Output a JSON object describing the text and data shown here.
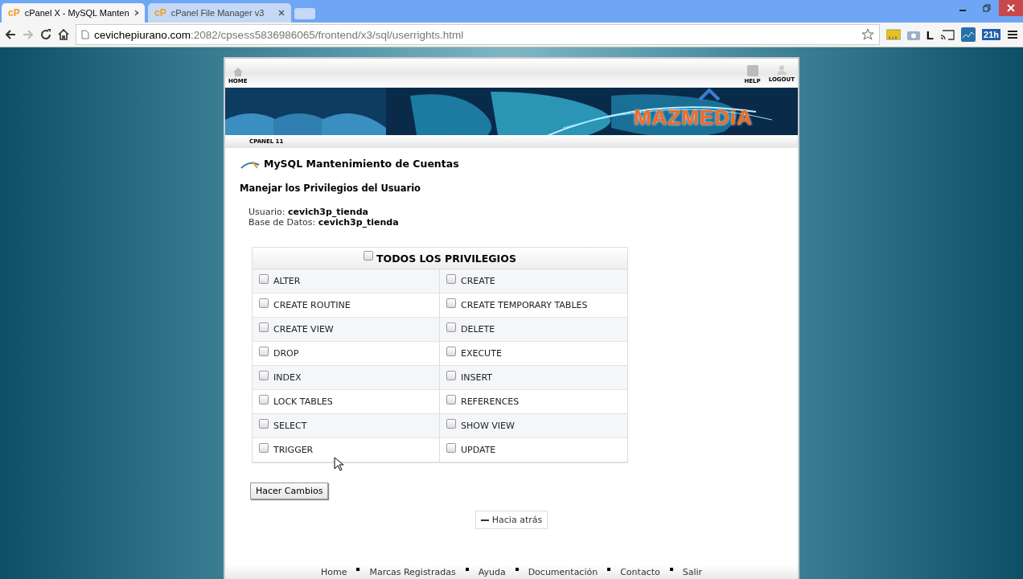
{
  "browser": {
    "tabs": [
      {
        "icon": "cP",
        "title": "cPanel X - MySQL Manten",
        "selected": true
      },
      {
        "icon": "cP",
        "title": "cPanel File Manager v3",
        "selected": false
      }
    ],
    "address": {
      "host": "cevichepiurano.com",
      "path": ":2082/cpsess5836986065/frontend/x3/sql/userrights.html"
    },
    "extensions": [
      {
        "kind": "ruler"
      },
      {
        "kind": "camera"
      },
      {
        "kind": "letter",
        "text": "L"
      },
      {
        "kind": "cast"
      },
      {
        "kind": "chart"
      },
      {
        "kind": "calendar",
        "text": "21h"
      }
    ]
  },
  "header": {
    "home": "HOME",
    "help": "HELP",
    "logout": "LOGOUT",
    "logo": "MAZMEDiA",
    "version": "CPANEL 11"
  },
  "page": {
    "title": "MySQL Mantenimiento de Cuentas",
    "subtitle": "Manejar los Privilegios del Usuario",
    "user_label": "Usuario:",
    "user": "cevich3p_tienda",
    "db_label": "Base de Datos:",
    "db": "cevich3p_tienda"
  },
  "privileges": {
    "all": {
      "label": "TODOS LOS PRIVILEGIOS",
      "checked": false
    },
    "items": [
      {
        "label": "ALTER",
        "checked": false
      },
      {
        "label": "CREATE",
        "checked": false
      },
      {
        "label": "CREATE ROUTINE",
        "checked": false
      },
      {
        "label": "CREATE TEMPORARY TABLES",
        "checked": false
      },
      {
        "label": "CREATE VIEW",
        "checked": false
      },
      {
        "label": "DELETE",
        "checked": false
      },
      {
        "label": "DROP",
        "checked": false
      },
      {
        "label": "EXECUTE",
        "checked": false
      },
      {
        "label": "INDEX",
        "checked": false
      },
      {
        "label": "INSERT",
        "checked": false
      },
      {
        "label": "LOCK TABLES",
        "checked": false
      },
      {
        "label": "REFERENCES",
        "checked": false
      },
      {
        "label": "SELECT",
        "checked": false
      },
      {
        "label": "SHOW VIEW",
        "checked": false
      },
      {
        "label": "TRIGGER",
        "checked": false
      },
      {
        "label": "UPDATE",
        "checked": false
      }
    ]
  },
  "submit": "Hacer Cambios",
  "back": "Hacia atrás",
  "footer": [
    "Home",
    "Marcas Registradas",
    "Ayuda",
    "Documentación",
    "Contacto",
    "Salir"
  ]
}
